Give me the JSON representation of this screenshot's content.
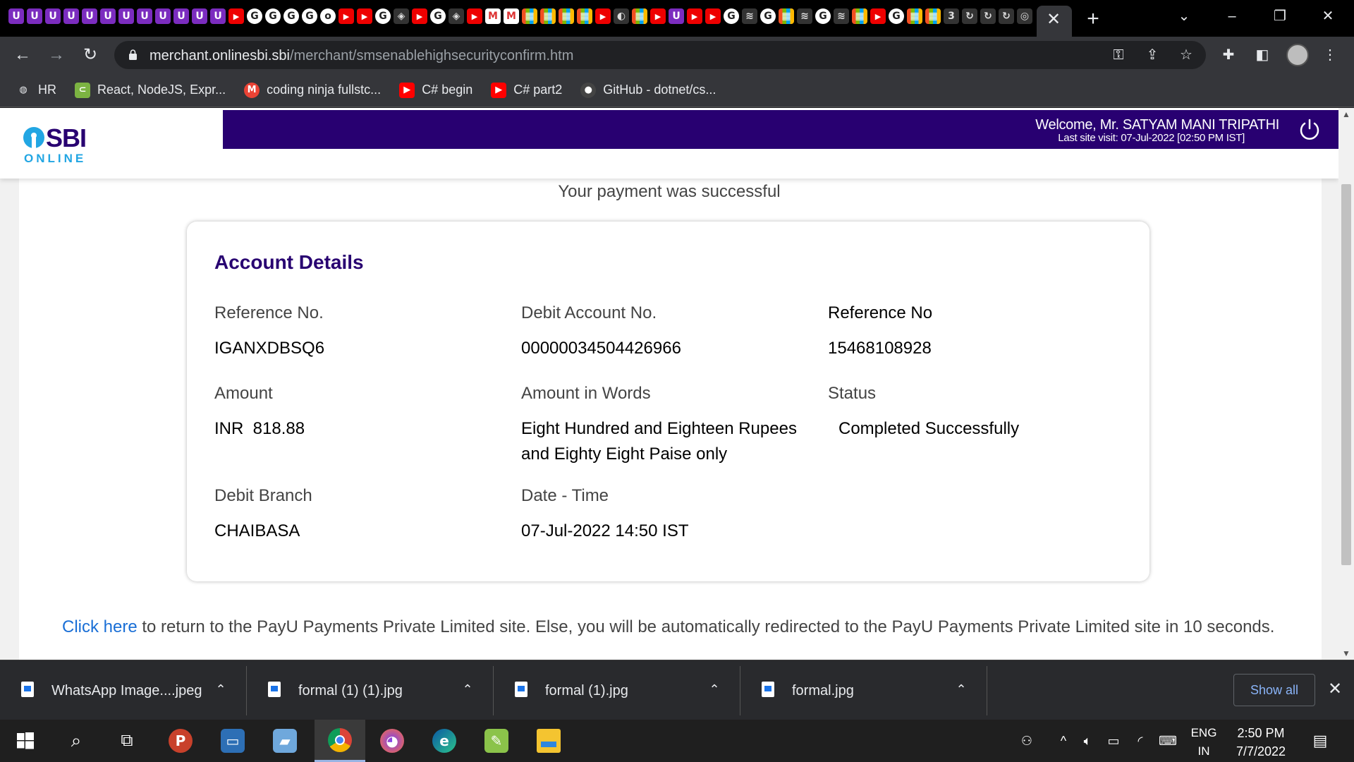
{
  "browser": {
    "tab_close_glyph": "✕",
    "new_tab_glyph": "+",
    "url_host": "merchant.onlinesbi.sbi",
    "url_path": "/merchant/smsenablehighsecurityconfirm.htm",
    "tab_favicons": [
      "U",
      "U",
      "U",
      "U",
      "U",
      "U",
      "U",
      "U",
      "U",
      "U",
      "U",
      "U",
      "▶",
      "G",
      "G",
      "G",
      "G",
      "o",
      "▶",
      "▶",
      "G",
      "◈",
      "▶",
      "G",
      "◈",
      "▶",
      "M",
      "M",
      "▦",
      "▦",
      "▦",
      "▦",
      "▶",
      "◐",
      "▦",
      "▶",
      "U",
      "▶",
      "▶",
      "G",
      "≋",
      "G",
      "▦",
      "≋",
      "G",
      "≋",
      "▦",
      "▶",
      "G",
      "▦",
      "▦",
      "3",
      "↻",
      "↻",
      "↻",
      "◎"
    ]
  },
  "bookmarks": [
    {
      "label": "HR",
      "icon": "globe-icon",
      "color": "#e8eaed"
    },
    {
      "label": "React, NodeJS, Expr...",
      "icon": "code-icon",
      "color": "#7cb342"
    },
    {
      "label": "coding ninja fullstc...",
      "icon": "gmail-icon",
      "color": "#ea4335"
    },
    {
      "label": "C# begin",
      "icon": "youtube-icon",
      "color": "#ff0000"
    },
    {
      "label": "C# part2",
      "icon": "youtube-icon",
      "color": "#ff0000"
    },
    {
      "label": "GitHub - dotnet/cs...",
      "icon": "github-icon",
      "color": "#444444"
    }
  ],
  "header": {
    "logo_text": "SBI",
    "logo_sub": "ONLINE",
    "welcome": "Welcome, Mr. SATYAM MANI TRIPATHI",
    "last_visit": "Last site visit: 07-Jul-2022 [02:50 PM IST]"
  },
  "page": {
    "success_message": "Your payment was successful",
    "card_title": "Account Details",
    "fields": {
      "ref_label": "Reference No.",
      "ref_value": "IGANXDBSQ6",
      "debit_acc_label": "Debit Account No.",
      "debit_acc_value": "00000034504426966",
      "ref2_label": "Reference No",
      "ref2_value": "15468108928",
      "amount_label": "Amount",
      "amount_value": "INR  818.88",
      "words_label": "Amount in Words",
      "words_value": "Eight Hundred and Eighteen Rupees and Eighty Eight Paise only",
      "status_label": "Status",
      "status_value": "Completed Successfully",
      "branch_label": "Debit Branch",
      "branch_value": "CHAIBASA",
      "datetime_label": "Date - Time",
      "datetime_value": "07-Jul-2022 14:50 IST"
    },
    "redirect_link": "Click here",
    "redirect_text": " to return to the PayU Payments Private Limited site. Else, you will be automatically redirected to the PayU Payments Private Limited site in 10 seconds."
  },
  "downloads": {
    "items": [
      "WhatsApp Image....jpeg",
      "formal (1) (1).jpg",
      "formal (1).jpg",
      "formal.jpg"
    ],
    "show_all": "Show all"
  },
  "taskbar": {
    "lang_top": "ENG",
    "lang_bottom": "IN",
    "time": "2:50 PM",
    "date": "7/7/2022"
  },
  "colors": {
    "sbi_purple": "#280071",
    "sbi_blue": "#22a6e3",
    "link": "#1a6fd6"
  }
}
